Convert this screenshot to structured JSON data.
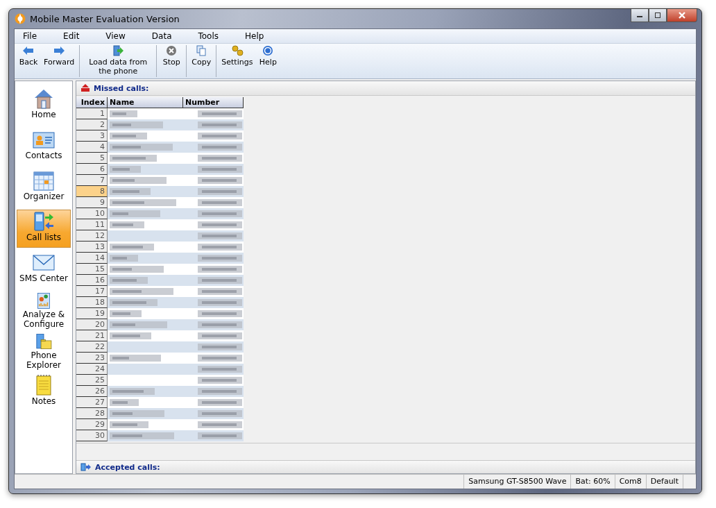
{
  "window": {
    "title": "Mobile Master Evaluation Version"
  },
  "menu": [
    "File",
    "Edit",
    "View",
    "Data",
    "Tools",
    "Help"
  ],
  "toolbar": [
    {
      "kind": "back",
      "label": "Back"
    },
    {
      "kind": "forward",
      "label": "Forward"
    },
    {
      "kind": "load",
      "label": "Load data from the phone",
      "separator_before": true
    },
    {
      "kind": "stop",
      "label": "Stop",
      "separator_before": true
    },
    {
      "kind": "copy",
      "label": "Copy",
      "separator_before": true
    },
    {
      "kind": "settings",
      "label": "Settings",
      "separator_before": true
    },
    {
      "kind": "help",
      "label": "Help"
    }
  ],
  "sidebar": {
    "items": [
      {
        "kind": "home",
        "label": "Home",
        "selected": false
      },
      {
        "kind": "contacts",
        "label": "Contacts",
        "selected": false
      },
      {
        "kind": "organizer",
        "label": "Organizer",
        "selected": false
      },
      {
        "kind": "calls",
        "label": "Call lists",
        "selected": true
      },
      {
        "kind": "sms",
        "label": "SMS Center",
        "selected": false
      },
      {
        "kind": "analyze",
        "label": "Analyze & Configure",
        "selected": false
      },
      {
        "kind": "explorer",
        "label": "Phone Explorer",
        "selected": false
      },
      {
        "kind": "notes",
        "label": "Notes",
        "selected": false
      }
    ]
  },
  "missed_calls": {
    "title": "Missed calls:",
    "columns": [
      "Index",
      "Name",
      "Number"
    ],
    "rows": [
      {
        "index": "1",
        "selected": false,
        "name_blurred": true
      },
      {
        "index": "2",
        "selected": false,
        "name_blurred": true
      },
      {
        "index": "3",
        "selected": false,
        "name_blurred": true
      },
      {
        "index": "4",
        "selected": false,
        "name_blurred": true
      },
      {
        "index": "5",
        "selected": false,
        "name_blurred": true
      },
      {
        "index": "6",
        "selected": false,
        "name_blurred": true
      },
      {
        "index": "7",
        "selected": false,
        "name_blurred": true
      },
      {
        "index": "8",
        "selected": true,
        "name_blurred": true
      },
      {
        "index": "9",
        "selected": false,
        "name_blurred": true
      },
      {
        "index": "10",
        "selected": false,
        "name_blurred": true
      },
      {
        "index": "11",
        "selected": false,
        "name_blurred": true
      },
      {
        "index": "12",
        "selected": false,
        "name_blurred": false
      },
      {
        "index": "13",
        "selected": false,
        "name_blurred": true
      },
      {
        "index": "14",
        "selected": false,
        "name_blurred": true
      },
      {
        "index": "15",
        "selected": false,
        "name_blurred": true
      },
      {
        "index": "16",
        "selected": false,
        "name_blurred": true
      },
      {
        "index": "17",
        "selected": false,
        "name_blurred": true
      },
      {
        "index": "18",
        "selected": false,
        "name_blurred": true
      },
      {
        "index": "19",
        "selected": false,
        "name_blurred": true
      },
      {
        "index": "20",
        "selected": false,
        "name_blurred": true
      },
      {
        "index": "21",
        "selected": false,
        "name_blurred": true
      },
      {
        "index": "22",
        "selected": false,
        "name_blurred": false
      },
      {
        "index": "23",
        "selected": false,
        "name_blurred": true
      },
      {
        "index": "24",
        "selected": false,
        "name_blurred": false
      },
      {
        "index": "25",
        "selected": false,
        "name_blurred": false
      },
      {
        "index": "26",
        "selected": false,
        "name_blurred": true
      },
      {
        "index": "27",
        "selected": false,
        "name_blurred": true
      },
      {
        "index": "28",
        "selected": false,
        "name_blurred": true
      },
      {
        "index": "29",
        "selected": false,
        "name_blurred": true
      },
      {
        "index": "30",
        "selected": false,
        "name_blurred": true
      }
    ]
  },
  "accepted_calls": {
    "title": "Accepted calls:"
  },
  "status_bar": [
    "Samsung GT-S8500 Wave",
    "Bat: 60%",
    "Com8",
    "Default"
  ]
}
